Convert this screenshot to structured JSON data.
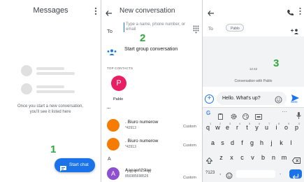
{
  "screen1": {
    "title": "Messages",
    "empty_message": "Once you start a new conversation, you'll see it listed here",
    "fab_label": "Start chat",
    "step_number": "1"
  },
  "screen2": {
    "title": "New conversation",
    "to_label": "To",
    "to_placeholder": "Type a name, phone number, or email",
    "step_number": "2",
    "group_conversation_label": "Start group conversation",
    "top_contacts_label": "TOP CONTACTS",
    "top_contact": {
      "initial": "P",
      "name": "Pablo",
      "color": "#e91e63"
    },
    "ellipsis": "...",
    "contacts": [
      {
        "initial": "",
        "name": ". Biuro numerow",
        "number": "*42913",
        "type": "Custom",
        "color": "#f57c00"
      },
      {
        "initial": "",
        "name": ". Biuro numerow",
        "number": "*42913",
        "type": "Custom",
        "color": "#f57c00"
      }
    ],
    "section_letter": "A",
    "last_contact": {
      "initial": "A",
      "name": "Ąąęąeńźśłąę",
      "number": "856985698526",
      "type": "Custom",
      "color": "#8e4fd1"
    }
  },
  "screen3": {
    "to_label": "To",
    "recipient_chip": "Pablo",
    "timestamp": "12:42",
    "conversation_with": "Conversation with Pablo",
    "step_number": "3",
    "compose_text": "Hello. What's up?",
    "send_label": "SMS",
    "keyboard": {
      "row1": [
        "q",
        "w",
        "e",
        "r",
        "t",
        "y",
        "u",
        "i",
        "o",
        "p"
      ],
      "row1_sup": [
        "1",
        "2",
        "3",
        "4",
        "5",
        "6",
        "7",
        "8",
        "9",
        "0"
      ],
      "row2": [
        "a",
        "s",
        "d",
        "f",
        "g",
        "h",
        "j",
        "k",
        "l"
      ],
      "row3": [
        "z",
        "x",
        "c",
        "v",
        "b",
        "n",
        "m"
      ],
      "symbols_key": "?123",
      "comma_key": ",",
      "period_key": "."
    }
  },
  "colors": {
    "accent_blue": "#1a73e8",
    "step_green": "#2eaa3c",
    "chip_gray": "#f1f3f4"
  }
}
